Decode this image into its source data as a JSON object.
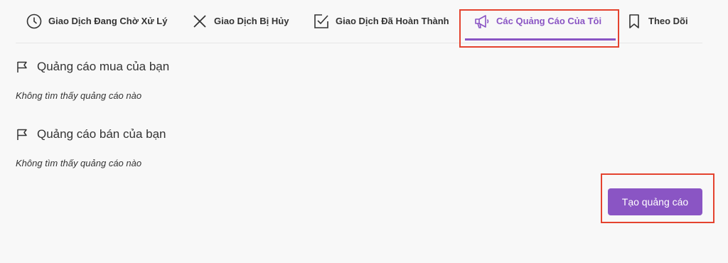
{
  "tabs": [
    {
      "label": "Giao Dịch Đang Chờ Xử Lý",
      "icon": "clock-icon"
    },
    {
      "label": "Giao Dịch Bị Hủy",
      "icon": "close-icon"
    },
    {
      "label": "Giao Dịch Đã Hoàn Thành",
      "icon": "checkbox-icon"
    },
    {
      "label": "Các Quảng Cáo Của Tôi",
      "icon": "megaphone-icon",
      "active": true
    },
    {
      "label": "Theo Dõi",
      "icon": "bookmark-icon"
    }
  ],
  "sections": [
    {
      "title": "Quảng cáo mua của bạn",
      "icon": "flag-icon",
      "empty_message": "Không tìm thấy quảng cáo nào"
    },
    {
      "title": "Quảng cáo bán của bạn",
      "icon": "flag-icon",
      "empty_message": "Không tìm thấy quảng cáo nào"
    }
  ],
  "actions": {
    "create_ad_label": "Tạo quảng cáo"
  },
  "colors": {
    "accent": "#8a55c4",
    "highlight": "#e4432f",
    "background": "#f8f8f8",
    "text": "#333333"
  }
}
